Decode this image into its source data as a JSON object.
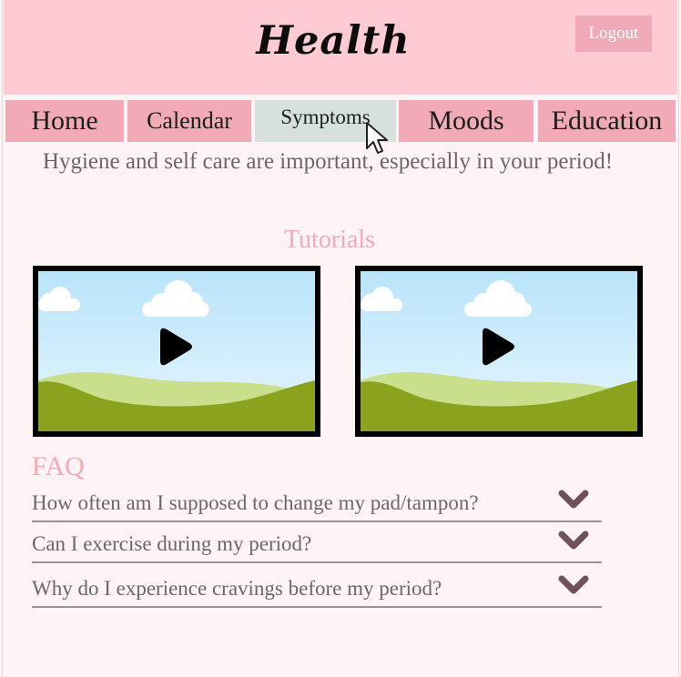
{
  "header": {
    "title": "Health",
    "logout_label": "Logout"
  },
  "nav": {
    "tabs": [
      {
        "label": "Home",
        "active": false
      },
      {
        "label": "Calendar",
        "active": false
      },
      {
        "label": "Symptoms",
        "active": true
      },
      {
        "label": "Moods",
        "active": false
      },
      {
        "label": "Education",
        "active": false
      }
    ]
  },
  "main": {
    "intro_text": "Hygiene and self care are important, especially in your period!",
    "tutorials_title": "Tutorials",
    "videos": [
      {
        "icon": "play-icon"
      },
      {
        "icon": "play-icon"
      }
    ]
  },
  "faq": {
    "title": "FAQ",
    "items": [
      {
        "question": "How often am I supposed to change my pad/tampon?",
        "icon": "chevron-down-icon"
      },
      {
        "question": "Can I exercise during my period?",
        "icon": "chevron-down-icon"
      },
      {
        "question": "Why do I experience cravings before my period?",
        "icon": "chevron-down-icon"
      }
    ]
  },
  "colors": {
    "header_bg": "#fecbd3",
    "tab_bg": "#f1aab6",
    "tab_active_bg": "#d7e1dc",
    "accent_text": "#f3a9b9",
    "body_text": "#6d6668",
    "chevron": "#6e5257"
  }
}
